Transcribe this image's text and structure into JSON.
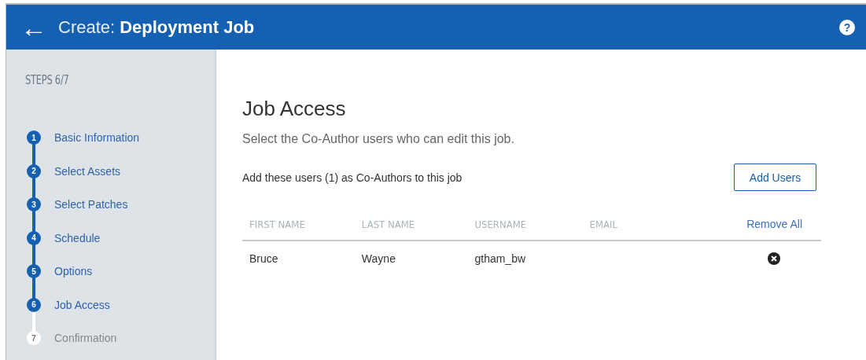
{
  "header": {
    "back": "←",
    "title_prefix": "Create:",
    "title": "Deployment Job",
    "help": "?"
  },
  "sidebar": {
    "heading": "STEPS 6/7",
    "steps": [
      {
        "number": "1",
        "label": "Basic Information",
        "completed": true
      },
      {
        "number": "2",
        "label": "Select Assets",
        "completed": true
      },
      {
        "number": "3",
        "label": "Select Patches",
        "completed": true
      },
      {
        "number": "4",
        "label": "Schedule",
        "completed": true
      },
      {
        "number": "5",
        "label": "Options",
        "completed": true
      },
      {
        "number": "6",
        "label": "Job Access",
        "completed": true
      },
      {
        "number": "7",
        "label": "Confirmation",
        "completed": false
      }
    ]
  },
  "main": {
    "title": "Job Access",
    "subtitle": "Select the Co-Author users who can edit this job.",
    "info": "Add these users (1) as Co-Authors to this job",
    "add_button": "Add Users",
    "table": {
      "columns": [
        "FIRST NAME",
        "LAST NAME",
        "USERNAME",
        "EMAIL"
      ],
      "remove_all": "Remove All",
      "rows": [
        {
          "cells": [
            "Bruce",
            "Wayne",
            "gtham_bw",
            ""
          ]
        }
      ]
    }
  }
}
